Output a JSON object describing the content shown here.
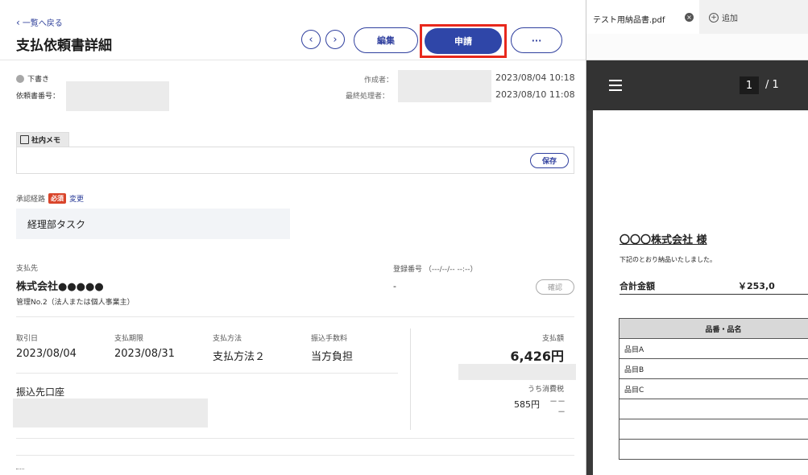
{
  "header": {
    "back_label": "一覧へ戻る",
    "title": "支払依頼書詳細",
    "edit_label": "編集",
    "apply_label": "申請",
    "more_label": "···"
  },
  "status": {
    "badge": "下書き",
    "request_number_label": "依頼書番号：",
    "creator_label": "作成者：",
    "created_at": "2023/08/04 10:18",
    "last_handler_label": "最終処理者：",
    "last_handled_at": "2023/08/10 11:08"
  },
  "memo": {
    "label": "社内メモ",
    "save_label": "保存"
  },
  "approval": {
    "label": "承認経路",
    "required_badge": "必須",
    "change_link": "変更",
    "route_value": "経理部タスク"
  },
  "payee": {
    "label": "支払先",
    "name": "株式会社●●●●●",
    "management": "管理No.2（法人または個人事業主）",
    "registration_label": "登録番号 （---/--/-- --:--）",
    "registration_value": "-",
    "confirm_label": "確認"
  },
  "details": {
    "trade_date_label": "取引日",
    "trade_date": "2023/08/04",
    "due_date_label": "支払期限",
    "due_date": "2023/08/31",
    "method_label": "支払方法",
    "method": "支払方法２",
    "fee_label": "振込手数料",
    "fee": "当方負担",
    "amount_label": "支払額",
    "amount": "6,426円",
    "tax_label": "うち消費税",
    "tax": "585円",
    "tax_suffix": "－－\n－",
    "account_label": "振込先口座"
  },
  "right_pane": {
    "tab_title": "テスト用納品書.pdf",
    "add_label": "追加",
    "page_current": "1",
    "page_sep": "/ 1"
  },
  "pdf": {
    "company": "〇〇〇株式会社 様",
    "note": "下記のとおり納品いたしました。",
    "total_label": "合計金額",
    "total_value": "￥253,0",
    "table_header": "品番・品名",
    "items": [
      "品目A",
      "品目B",
      "品目C"
    ]
  }
}
